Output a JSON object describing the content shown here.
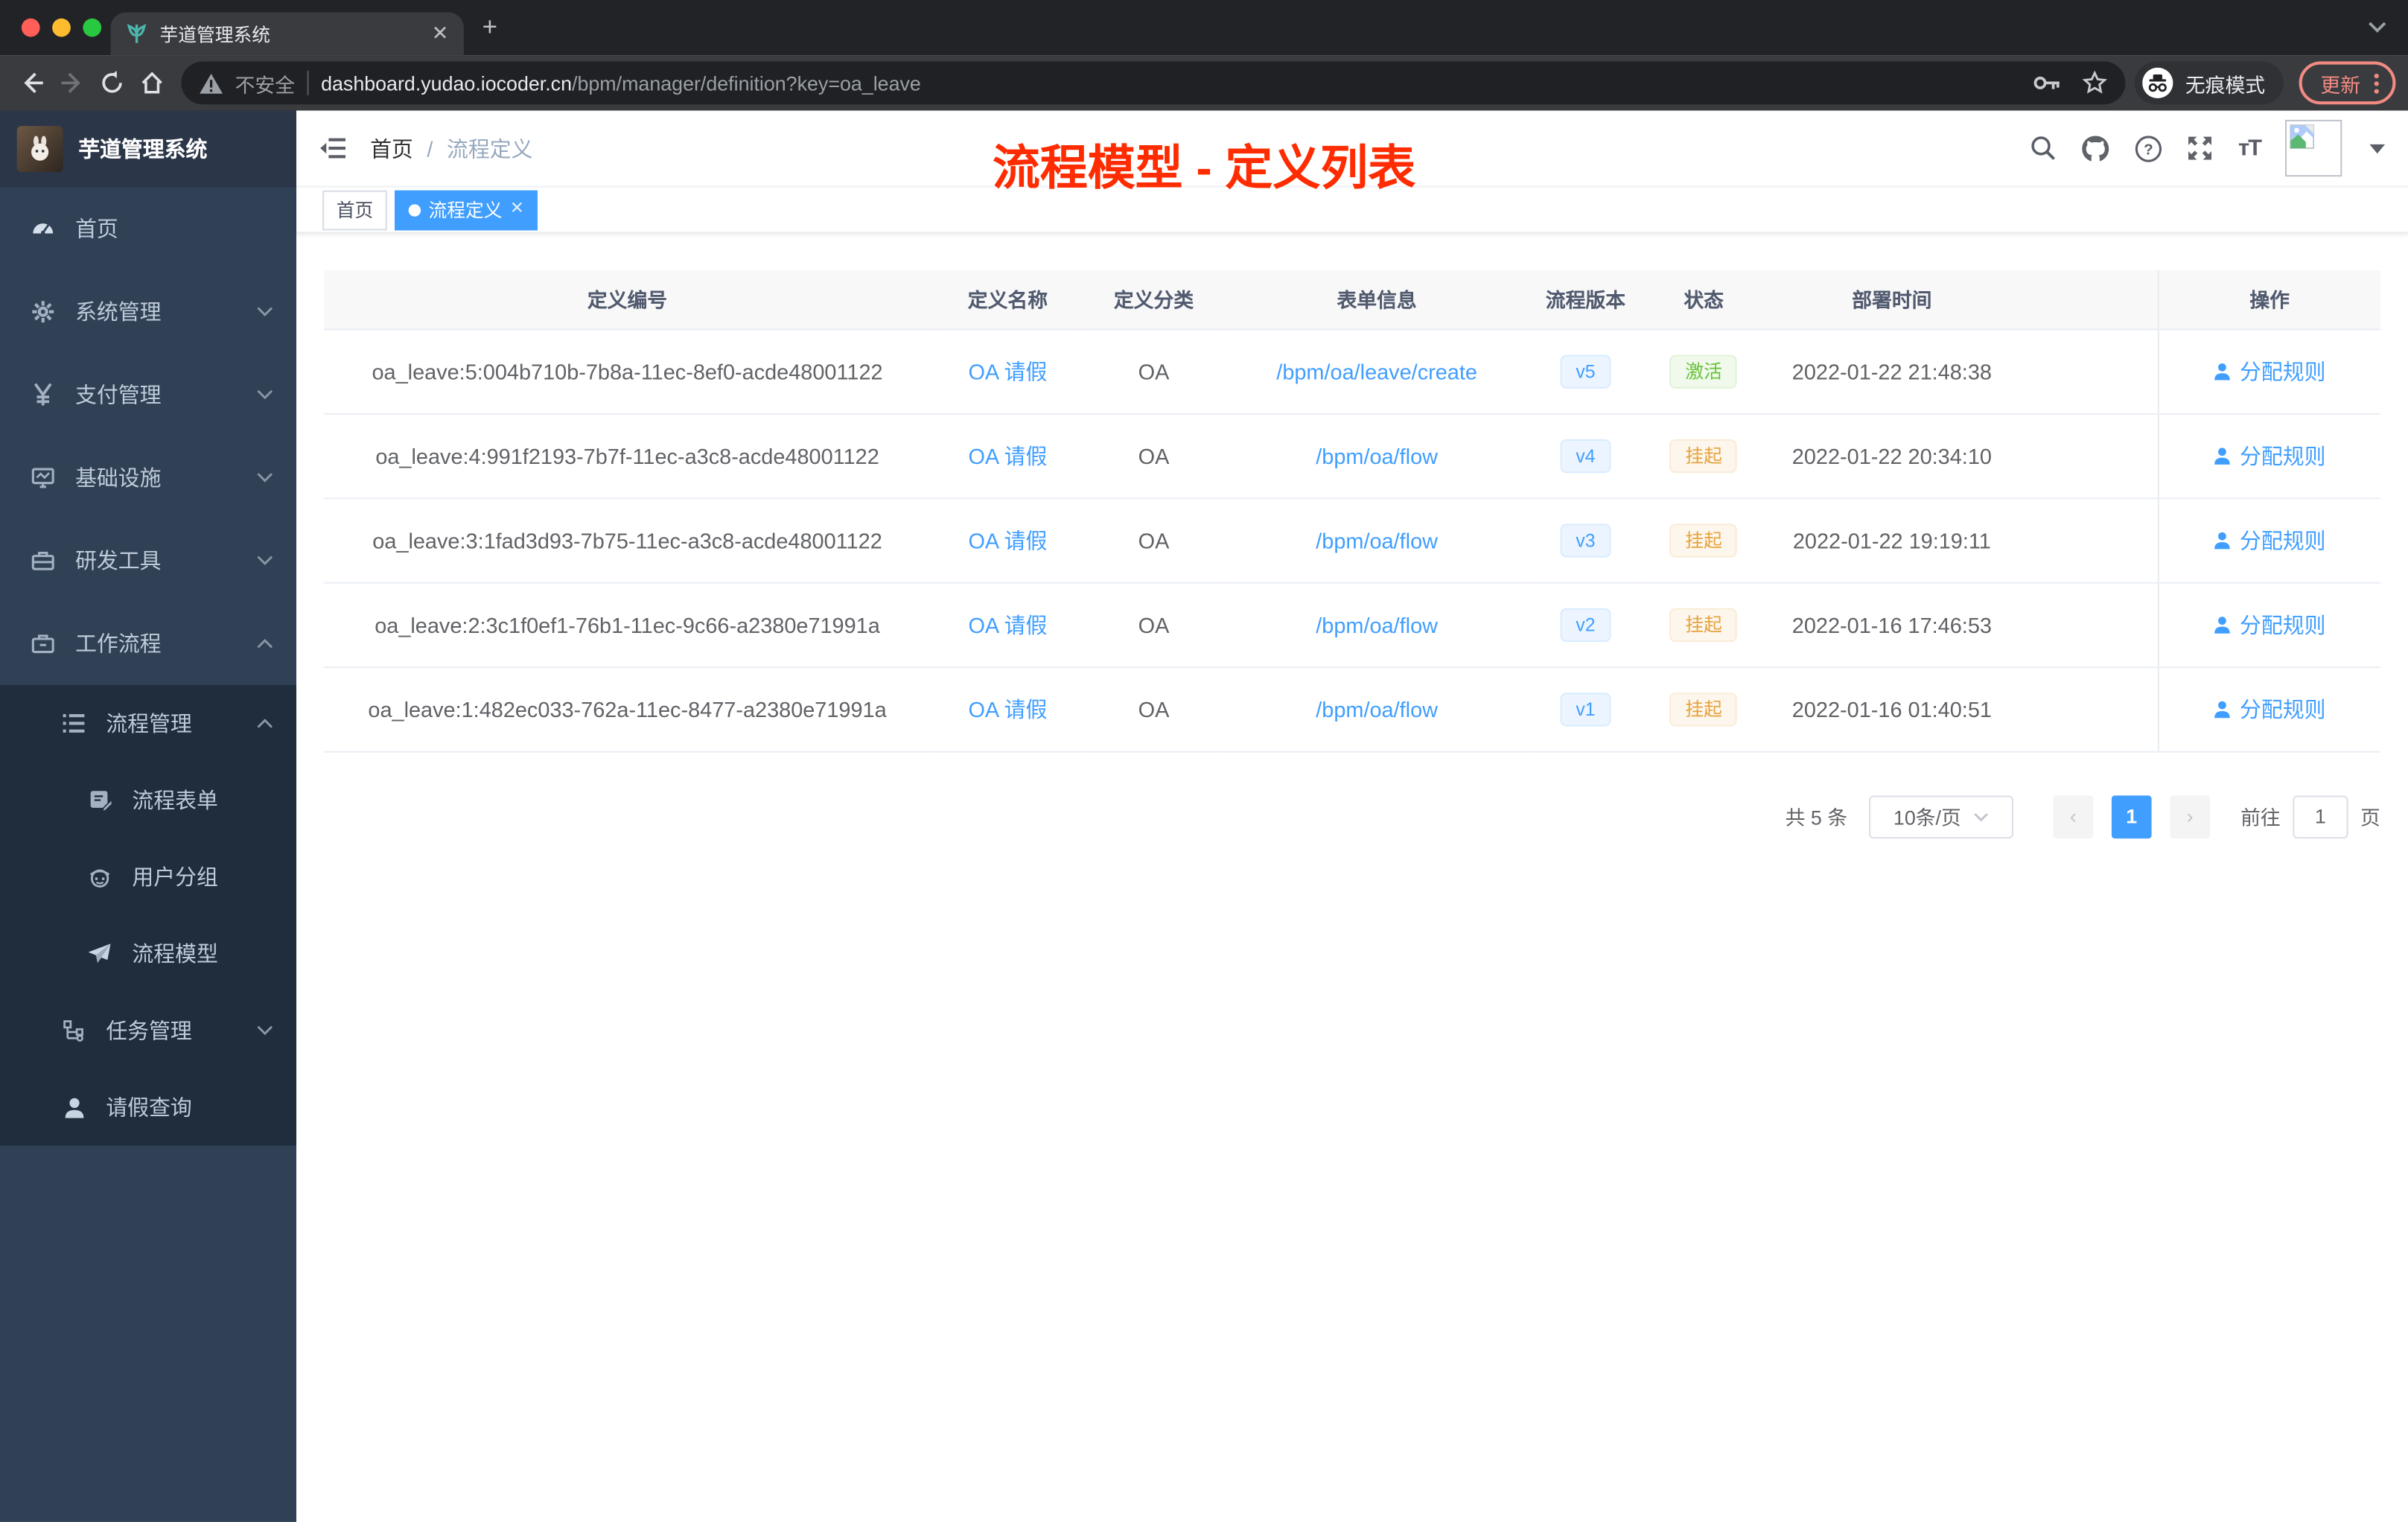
{
  "browser": {
    "tab_title": "芋道管理系统",
    "security_label": "不安全",
    "url_domain": "dashboard.yudao.iocoder.cn",
    "url_path": "/bpm/manager/definition?key=oa_leave",
    "incognito_label": "无痕模式",
    "update_label": "更新"
  },
  "sidebar": {
    "logo_title": "芋道管理系统",
    "items": [
      {
        "icon": "dashboard-icon",
        "label": "首页"
      },
      {
        "icon": "gear-icon",
        "label": "系统管理",
        "chevron": "down"
      },
      {
        "icon": "yen-icon",
        "label": "支付管理",
        "chevron": "down"
      },
      {
        "icon": "monitor-icon",
        "label": "基础设施",
        "chevron": "down"
      },
      {
        "icon": "toolbox-icon",
        "label": "研发工具",
        "chevron": "down"
      },
      {
        "icon": "workflow-icon",
        "label": "工作流程",
        "chevron": "up"
      }
    ],
    "submenu": [
      {
        "icon": "list-icon",
        "label": "流程管理",
        "chevron": "up"
      },
      {
        "icon": "form-icon",
        "label": "流程表单"
      },
      {
        "icon": "group-icon",
        "label": "用户分组"
      },
      {
        "icon": "model-icon",
        "label": "流程模型"
      },
      {
        "icon": "task-icon",
        "label": "任务管理",
        "chevron": "down"
      },
      {
        "icon": "leave-icon",
        "label": "请假查询"
      }
    ]
  },
  "header": {
    "breadcrumb_root": "首页",
    "breadcrumb_sep": "/",
    "breadcrumb_current": "流程定义",
    "annotation": "流程模型 - 定义列表"
  },
  "tags": {
    "items": [
      {
        "label": "首页",
        "active": false
      },
      {
        "label": "流程定义",
        "active": true
      }
    ]
  },
  "table": {
    "columns": [
      "定义编号",
      "定义名称",
      "定义分类",
      "表单信息",
      "流程版本",
      "状态",
      "部署时间",
      "操作"
    ],
    "rows": [
      {
        "id": "oa_leave:5:004b710b-7b8a-11ec-8ef0-acde48001122",
        "name": "OA 请假",
        "category": "OA",
        "form": "/bpm/oa/leave/create",
        "version": "v5",
        "status": "激活",
        "status_type": "success",
        "time": "2022-01-22 21:48:38",
        "action": "分配规则"
      },
      {
        "id": "oa_leave:4:991f2193-7b7f-11ec-a3c8-acde48001122",
        "name": "OA 请假",
        "category": "OA",
        "form": "/bpm/oa/flow",
        "version": "v4",
        "status": "挂起",
        "status_type": "warning",
        "time": "2022-01-22 20:34:10",
        "action": "分配规则"
      },
      {
        "id": "oa_leave:3:1fad3d93-7b75-11ec-a3c8-acde48001122",
        "name": "OA 请假",
        "category": "OA",
        "form": "/bpm/oa/flow",
        "version": "v3",
        "status": "挂起",
        "status_type": "warning",
        "time": "2022-01-22 19:19:11",
        "action": "分配规则"
      },
      {
        "id": "oa_leave:2:3c1f0ef1-76b1-11ec-9c66-a2380e71991a",
        "name": "OA 请假",
        "category": "OA",
        "form": "/bpm/oa/flow",
        "version": "v2",
        "status": "挂起",
        "status_type": "warning",
        "time": "2022-01-16 17:46:53",
        "action": "分配规则"
      },
      {
        "id": "oa_leave:1:482ec033-762a-11ec-8477-a2380e71991a",
        "name": "OA 请假",
        "category": "OA",
        "form": "/bpm/oa/flow",
        "version": "v1",
        "status": "挂起",
        "status_type": "warning",
        "time": "2022-01-16 01:40:51",
        "action": "分配规则"
      }
    ]
  },
  "pagination": {
    "total": "共 5 条",
    "page_size": "10条/页",
    "current_page": "1",
    "goto_label": "前往",
    "goto_value": "1",
    "goto_suffix": "页"
  },
  "colors": {
    "accent": "#409eff",
    "success": "#67c23a",
    "warning": "#e6a23c",
    "annotation_red": "#fe2c00",
    "update_pill": "#f28b82",
    "sidebar_bg": "#304156",
    "submenu_bg": "#1f2d3d"
  }
}
